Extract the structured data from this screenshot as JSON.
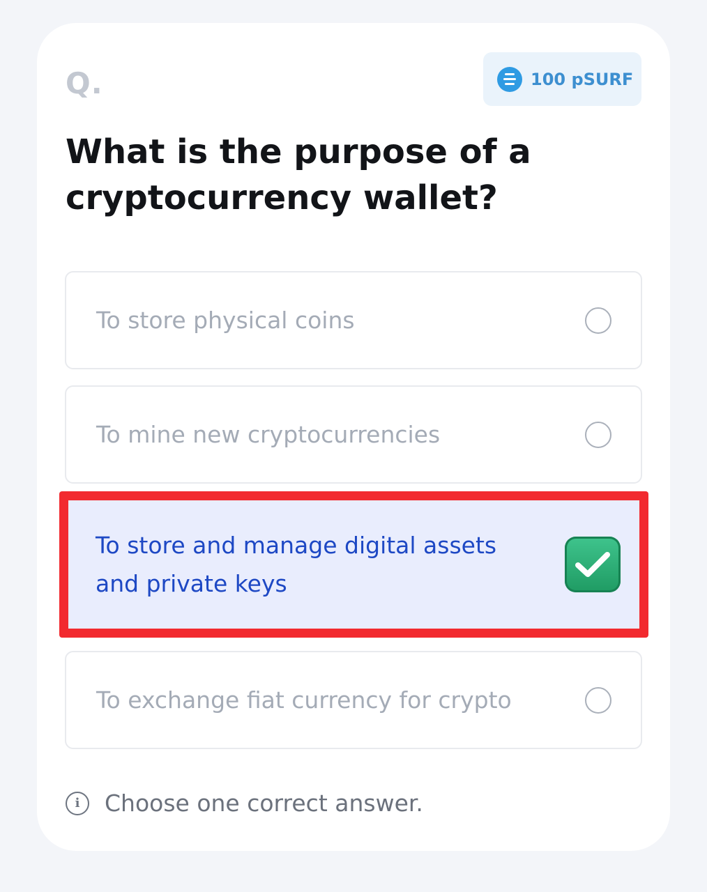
{
  "header": {
    "question_marker": "Q.",
    "reward": {
      "label": "100 pSURF",
      "icon": "coin-icon",
      "color": "#2f9be3"
    }
  },
  "question": {
    "text": "What is the purpose of a cryptocurrency wallet?"
  },
  "options": [
    {
      "label": "To store physical coins",
      "selected": false
    },
    {
      "label": "To mine new cryptocurrencies",
      "selected": false
    },
    {
      "label": "To store and manage digital assets and private keys",
      "selected": true
    },
    {
      "label": "To exchange fiat currency for crypto",
      "selected": false
    }
  ],
  "hint": {
    "text": "Choose one correct answer.",
    "icon": "info-icon"
  },
  "colors": {
    "selected_text": "#1d48c4",
    "selected_background": "#e9edfd",
    "highlight_border": "#f22a2f",
    "check_green": "#1f9b63"
  }
}
